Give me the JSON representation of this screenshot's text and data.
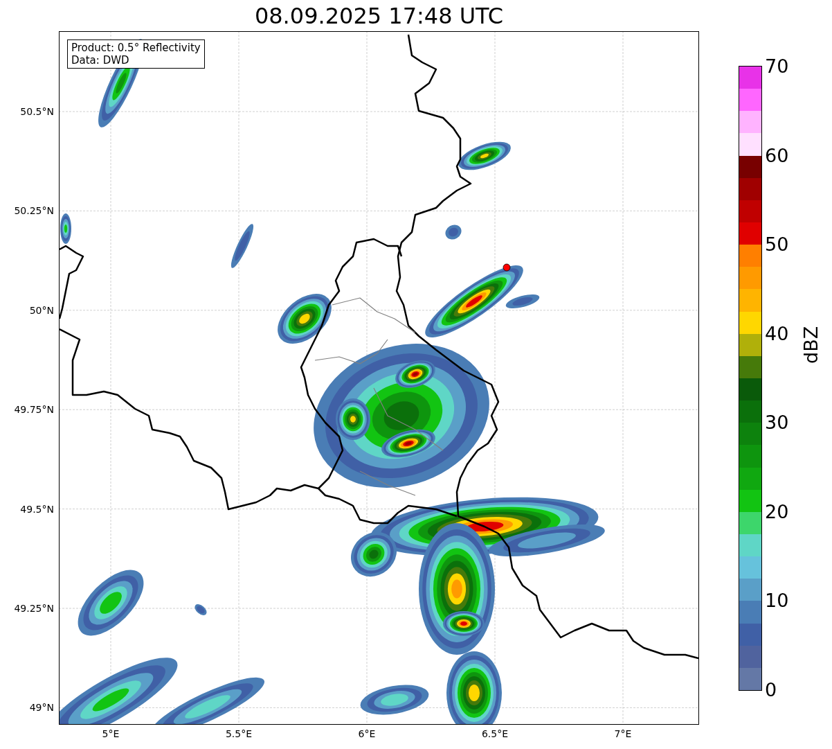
{
  "title": "08.09.2025 17:48 UTC",
  "info_box": [
    "Product: 0.5° Reflectivity",
    "Data: DWD"
  ],
  "map": {
    "y_ticks": [
      "50.5°N",
      "50.25°N",
      "50°N",
      "49.75°N",
      "49.5°N",
      "49.25°N",
      "49°N"
    ],
    "x_ticks": [
      "5°E",
      "5.5°E",
      "6°E",
      "6.5°E",
      "7°E"
    ]
  },
  "colorbar": {
    "label": "dBZ",
    "ticks": [
      "70",
      "60",
      "50",
      "40",
      "30",
      "20",
      "10",
      "0"
    ],
    "segments": [
      {
        "color": "#6478a6"
      },
      {
        "color": "#50639e"
      },
      {
        "color": "#4060a6"
      },
      {
        "color": "#4a7db5"
      },
      {
        "color": "#5a9fc8"
      },
      {
        "color": "#66c2dc"
      },
      {
        "color": "#5fd6c6"
      },
      {
        "color": "#3dd66b"
      },
      {
        "color": "#12c412"
      },
      {
        "color": "#10a810"
      },
      {
        "color": "#0e950e"
      },
      {
        "color": "#0d820d"
      },
      {
        "color": "#0b700b"
      },
      {
        "color": "#0a5a0a"
      },
      {
        "color": "#467a0a"
      },
      {
        "color": "#b0b00a"
      },
      {
        "color": "#ffd700"
      },
      {
        "color": "#ffb400"
      },
      {
        "color": "#ff9a00"
      },
      {
        "color": "#ff7f00"
      },
      {
        "color": "#e00000"
      },
      {
        "color": "#c00000"
      },
      {
        "color": "#a00000"
      },
      {
        "color": "#780000"
      },
      {
        "color": "#ffe0ff"
      },
      {
        "color": "#ffb3ff"
      },
      {
        "color": "#ff66ff"
      },
      {
        "color": "#e832e8"
      }
    ]
  }
}
